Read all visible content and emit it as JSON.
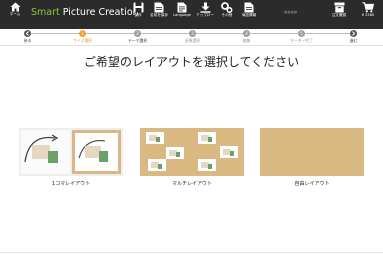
{
  "app": {
    "brand_smart": "Smart",
    "brand_rest": " Picture Creation",
    "ghost_label": "■■■■"
  },
  "toolbar": {
    "home_label": "ホーム",
    "save_label": "保存",
    "save_as_label": "名前を保存",
    "language_label": "Language",
    "upload_label": "アップロー",
    "other_label": "その他",
    "print_label": "商品情報",
    "order_label": "注文確認",
    "cart_label": "¥ 2580"
  },
  "steps": {
    "back_label": "戻る",
    "next_label": "進む",
    "items": [
      {
        "num": "1",
        "label": "サイズ選択"
      },
      {
        "num": "2",
        "label": "テーマ選択"
      },
      {
        "num": "3",
        "label": "画像選択"
      },
      {
        "num": "4",
        "label": "編集"
      },
      {
        "num": "5",
        "label": "オーダー完了"
      }
    ]
  },
  "main": {
    "heading": "ご希望のレイアウトを選択してください",
    "options": [
      {
        "label": "1コマレイアウト"
      },
      {
        "label": "マルチレイアウト"
      },
      {
        "label": "自由レイアウト"
      }
    ]
  },
  "colors": {
    "topbar": "#2b2b2b",
    "brand_green": "#8cc63f",
    "active_step": "#f0a030",
    "kraft": "#d9b882"
  }
}
